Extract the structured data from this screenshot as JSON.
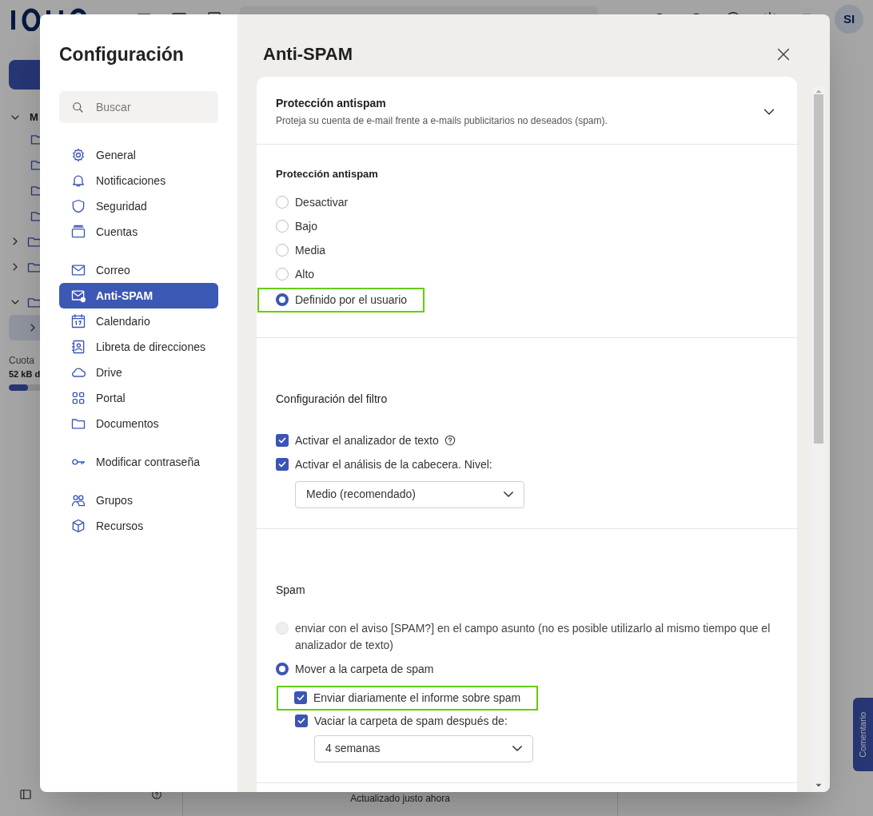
{
  "app": {
    "avatar": "SI",
    "tree_label": "M",
    "quota_label": "Cuota",
    "quota_value": "52 kB d",
    "quota": {
      "level": 0.12
    },
    "status": "Actualizado justo ahora",
    "feedback_button": "Comentario"
  },
  "dialog": {
    "title": "Configuración",
    "search": {
      "placeholder": "Buscar"
    },
    "nav_groups": [
      {
        "items": [
          {
            "label": "General",
            "selected": false
          },
          {
            "label": "Notificaciones",
            "selected": false
          },
          {
            "label": "Seguridad",
            "selected": false
          },
          {
            "label": "Cuentas",
            "selected": false
          }
        ]
      },
      {
        "items": [
          {
            "label": "Correo",
            "selected": false
          },
          {
            "label": "Anti-SPAM",
            "selected": true
          },
          {
            "label": "Calendario",
            "selected": false
          },
          {
            "label": "Libreta de direcciones",
            "selected": false
          },
          {
            "label": "Drive",
            "selected": false
          },
          {
            "label": "Portal",
            "selected": false
          },
          {
            "label": "Documentos",
            "selected": false
          }
        ]
      },
      {
        "items": [
          {
            "label": "Modificar contraseña",
            "selected": false
          }
        ]
      },
      {
        "items": [
          {
            "label": "Grupos",
            "selected": false
          },
          {
            "label": "Recursos",
            "selected": false
          }
        ]
      }
    ],
    "panel_title": "Anti-SPAM",
    "header": {
      "title": "Protección antispam",
      "subtitle": "Proteja su cuenta de e-mail frente a e-mails publicitarios no deseados (spam).",
      "expanded": false
    },
    "sections": [
      {
        "title": "Protección antispam",
        "items": [
          {
            "kind": "radio",
            "label": "Desactivar",
            "selected": false,
            "disabled": false,
            "highlighted": false
          },
          {
            "kind": "radio",
            "label": "Bajo",
            "selected": false,
            "disabled": false,
            "highlighted": false
          },
          {
            "kind": "radio",
            "label": "Media",
            "selected": false,
            "disabled": false,
            "highlighted": false
          },
          {
            "kind": "radio",
            "label": "Alto",
            "selected": false,
            "disabled": false,
            "highlighted": false
          },
          {
            "kind": "radio",
            "label": "Definido por el usuario",
            "selected": true,
            "disabled": false,
            "highlighted": true
          }
        ]
      },
      {
        "title": "Configuración del filtro",
        "items": [
          {
            "kind": "checkbox",
            "label": "Activar el analizador de texto",
            "checked": true,
            "help": true,
            "highlighted": false
          },
          {
            "kind": "checkbox",
            "label": "Activar el análisis de la cabecera. Nivel:",
            "checked": true,
            "help": false,
            "highlighted": false
          },
          {
            "kind": "select",
            "value": "Medio (recomendado)"
          }
        ]
      },
      {
        "title": "Spam",
        "items": [
          {
            "kind": "radio",
            "label": "enviar con el aviso [SPAM?] en el campo asunto (no es posible utilizarlo al mismo tiempo que el analizador de texto)",
            "selected": false,
            "disabled": true,
            "highlighted": false
          },
          {
            "kind": "radio",
            "label": "Mover a la carpeta de spam",
            "selected": true,
            "disabled": false,
            "highlighted": false,
            "children": [
              {
                "kind": "checkbox",
                "label": "Enviar diariamente el informe sobre spam",
                "checked": true,
                "help": false,
                "highlighted": true
              },
              {
                "kind": "checkbox",
                "label": "Vaciar la carpeta de spam después de:",
                "checked": true,
                "help": false,
                "highlighted": false
              },
              {
                "kind": "select",
                "value": "4 semanas"
              }
            ]
          }
        ]
      }
    ]
  }
}
